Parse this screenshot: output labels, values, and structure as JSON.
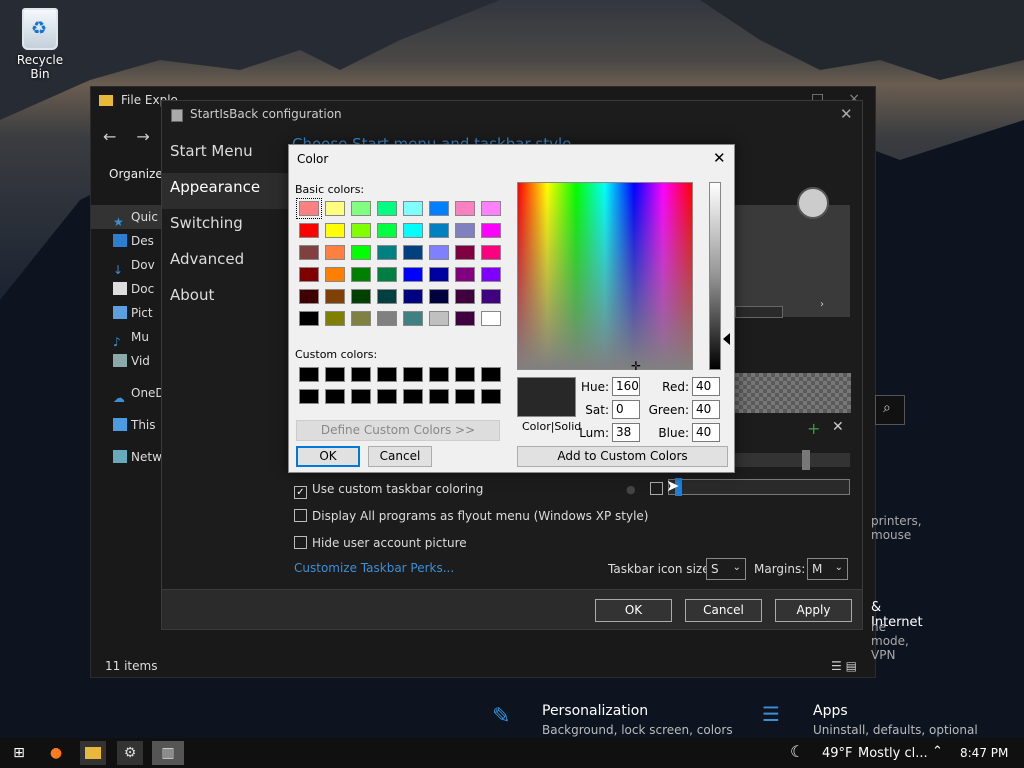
{
  "desktop": {
    "recycle_bin": "Recycle Bin"
  },
  "file_explorer": {
    "title": "File Explo",
    "organize": "Organize",
    "sidebar": [
      "Quic",
      "Des",
      "Dov",
      "Doc",
      "Pict",
      "Mu",
      "Vid",
      "OneD",
      "This",
      "Netw"
    ],
    "status": "11 items",
    "right_text1": "printers, mouse",
    "right_text2": "& Internet",
    "right_text3": "ne mode, VPN"
  },
  "settings_peek": {
    "personalization_title": "Personalization",
    "personalization_sub": "Background, lock screen, colors",
    "apps_title": "Apps",
    "apps_sub": "Uninstall, defaults, optional"
  },
  "startisback": {
    "title": "StartIsBack configuration",
    "nav": [
      "Start Menu",
      "Appearance",
      "Switching",
      "Advanced",
      "About"
    ],
    "header": "Choose Start menu and taskbar style",
    "options": [
      {
        "label": "Use custom taskbar coloring",
        "checked": true
      },
      {
        "label": "Display All programs as flyout menu (Windows XP style)",
        "checked": false
      },
      {
        "label": "Hide user account picture",
        "checked": false
      }
    ],
    "customize_link": "Customize Taskbar Perks...",
    "taskbar_icon_label": "Taskbar icon size:",
    "taskbar_icon_value": "S",
    "margins_label": "Margins:",
    "margins_value": "M",
    "ok": "OK",
    "cancel": "Cancel",
    "apply": "Apply"
  },
  "color_dialog": {
    "title": "Color",
    "basic_colors_label": "Basic colors:",
    "custom_colors_label": "Custom colors:",
    "define_custom": "Define Custom Colors >>",
    "ok": "OK",
    "cancel": "Cancel",
    "add_custom": "Add to Custom Colors",
    "color_solid": "Color|Solid",
    "hue_label": "Hue:",
    "hue": "160",
    "sat_label": "Sat:",
    "sat": "0",
    "lum_label": "Lum:",
    "lum": "38",
    "red_label": "Red:",
    "red": "40",
    "green_label": "Green:",
    "green": "40",
    "blue_label": "Blue:",
    "blue": "40",
    "current_color": "#282828",
    "basic_colors": [
      "#ff8080",
      "#ffff80",
      "#80ff80",
      "#00ff80",
      "#80ffff",
      "#0080ff",
      "#ff80c0",
      "#ff80ff",
      "#ff0000",
      "#ffff00",
      "#80ff00",
      "#00ff40",
      "#00ffff",
      "#0080c0",
      "#8080c0",
      "#ff00ff",
      "#804040",
      "#ff8040",
      "#00ff00",
      "#008080",
      "#004080",
      "#8080ff",
      "#800040",
      "#ff0080",
      "#800000",
      "#ff8000",
      "#008000",
      "#008040",
      "#0000ff",
      "#0000a0",
      "#800080",
      "#8000ff",
      "#400000",
      "#804000",
      "#004000",
      "#004040",
      "#000080",
      "#000040",
      "#400040",
      "#400080",
      "#000000",
      "#808000",
      "#808040",
      "#808080",
      "#408080",
      "#c0c0c0",
      "#400040",
      "#ffffff"
    ],
    "custom_colors": [
      "#000000",
      "#000000",
      "#000000",
      "#000000",
      "#000000",
      "#000000",
      "#000000",
      "#000000",
      "#000000",
      "#000000",
      "#000000",
      "#000000",
      "#000000",
      "#000000",
      "#000000",
      "#000000"
    ]
  },
  "taskbar": {
    "weather": "49°F",
    "weather_desc": "Mostly cl...",
    "time": "8:47 PM"
  }
}
